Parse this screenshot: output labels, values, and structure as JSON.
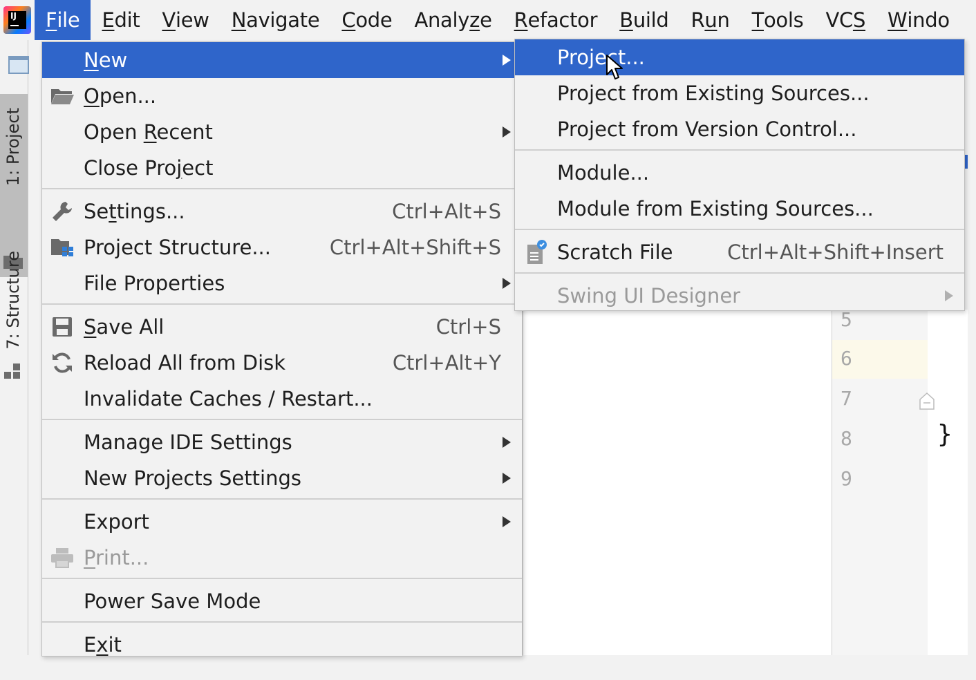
{
  "menubar": {
    "items": [
      {
        "id": "file",
        "before": "",
        "mnemonic": "F",
        "after": "ile"
      },
      {
        "id": "edit",
        "before": "",
        "mnemonic": "E",
        "after": "dit"
      },
      {
        "id": "view",
        "before": "",
        "mnemonic": "V",
        "after": "iew"
      },
      {
        "id": "navigate",
        "before": "",
        "mnemonic": "N",
        "after": "avigate"
      },
      {
        "id": "code",
        "before": "",
        "mnemonic": "C",
        "after": "ode"
      },
      {
        "id": "analyze",
        "before": "Analy",
        "mnemonic": "z",
        "after": "e"
      },
      {
        "id": "refactor",
        "before": "",
        "mnemonic": "R",
        "after": "efactor"
      },
      {
        "id": "build",
        "before": "",
        "mnemonic": "B",
        "after": "uild"
      },
      {
        "id": "run",
        "before": "R",
        "mnemonic": "u",
        "after": "n"
      },
      {
        "id": "tools",
        "before": "",
        "mnemonic": "T",
        "after": "ools"
      },
      {
        "id": "vcs",
        "before": "VC",
        "mnemonic": "S",
        "after": ""
      },
      {
        "id": "window",
        "before": "",
        "mnemonic": "W",
        "after": "indo"
      }
    ]
  },
  "left_strip": {
    "project_tab": "1: Project",
    "structure_tab": "7: Structure"
  },
  "file_menu": {
    "new": {
      "before": "",
      "mnemonic": "N",
      "after": "ew"
    },
    "open": {
      "before": "",
      "mnemonic": "O",
      "after": "pen..."
    },
    "open_recent": {
      "before": "Open ",
      "mnemonic": "R",
      "after": "ecent"
    },
    "close_project": {
      "before": "Close Pro",
      "mnemonic": "j",
      "after": "ect"
    },
    "settings": {
      "before": "Se",
      "mnemonic": "t",
      "after": "tings...",
      "shortcut": "Ctrl+Alt+S"
    },
    "project_structure": {
      "label": "Project Structure...",
      "shortcut": "Ctrl+Alt+Shift+S"
    },
    "file_properties": {
      "label": "File Properties"
    },
    "save_all": {
      "before": "",
      "mnemonic": "S",
      "after": "ave All",
      "shortcut": "Ctrl+S"
    },
    "reload_all": {
      "label": "Reload All from Disk",
      "shortcut": "Ctrl+Alt+Y"
    },
    "invalidate_caches": {
      "label": "Invalidate Caches / Restart..."
    },
    "manage_ide_settings": {
      "label": "Manage IDE Settings"
    },
    "new_projects_settings": {
      "label": "New Projects Settings"
    },
    "export": {
      "label": "Export"
    },
    "print": {
      "before": "",
      "mnemonic": "P",
      "after": "rint..."
    },
    "power_save_mode": {
      "label": "Power Save Mode"
    },
    "exit": {
      "before": "E",
      "mnemonic": "x",
      "after": "it"
    }
  },
  "new_submenu": {
    "project": "Project...",
    "project_from_existing": "Project from Existing Sources...",
    "project_from_vcs": "Project from Version Control...",
    "module": "Module...",
    "module_from_existing": "Module from Existing Sources...",
    "scratch_file": {
      "label": "Scratch File",
      "shortcut": "Ctrl+Alt+Shift+Insert"
    },
    "swing_ui_designer": "Swing UI Designer"
  },
  "editor": {
    "line_numbers": [
      "5",
      "6",
      "7",
      "8",
      "9"
    ],
    "code_visible": "}"
  },
  "colors": {
    "selection": "#2f65ca",
    "menu_bg": "#f2f2f2",
    "current_line": "#fcf9ea"
  }
}
